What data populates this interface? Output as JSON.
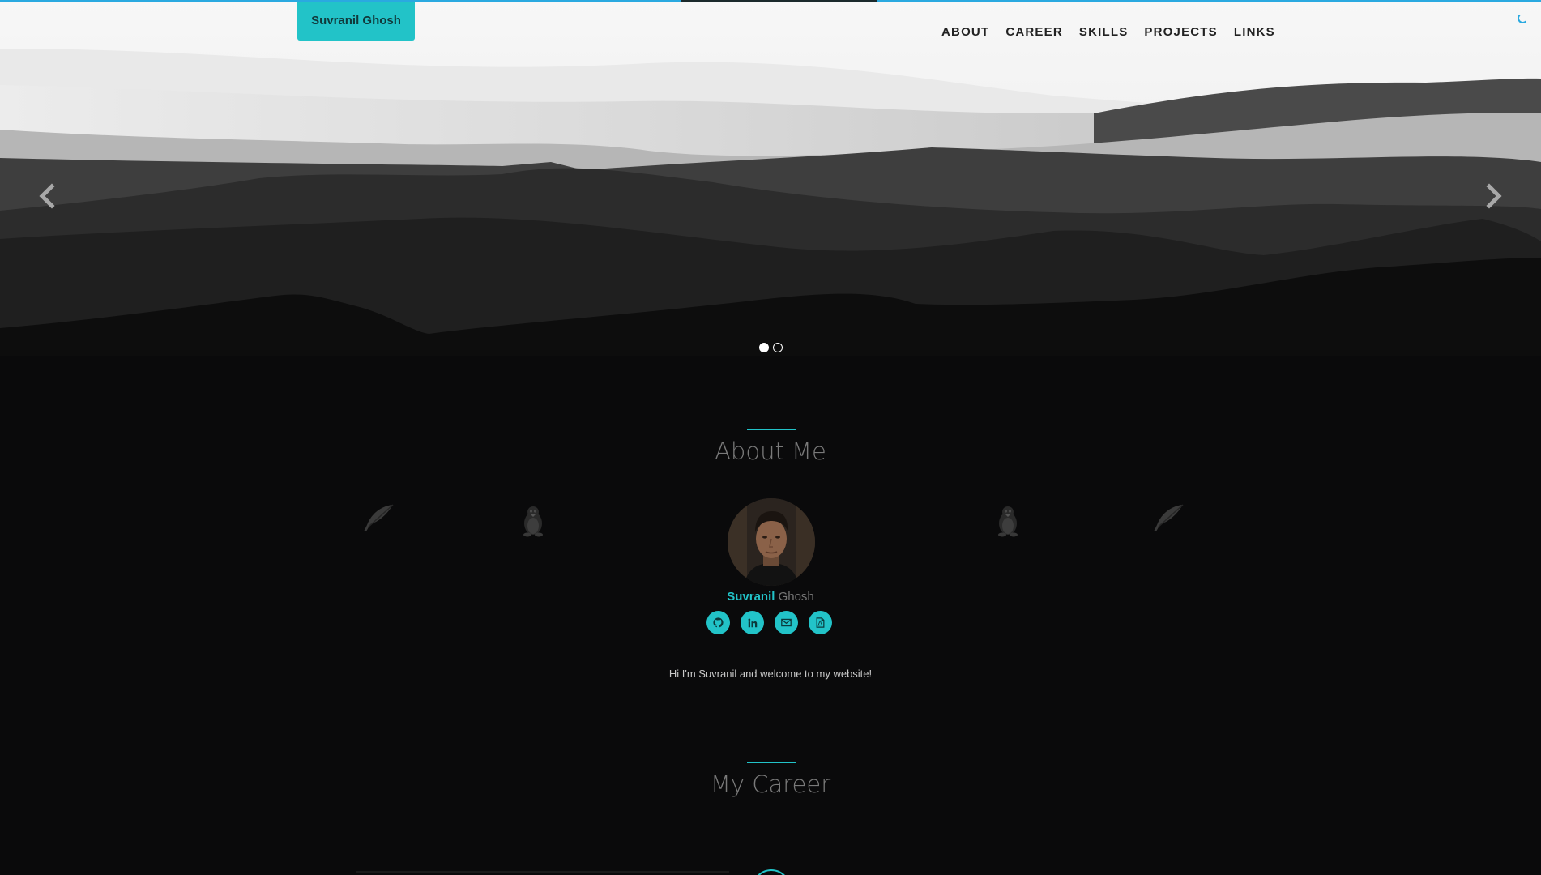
{
  "header": {
    "brand": "Suvranil Ghosh",
    "nav": [
      "ABOUT",
      "CAREER",
      "SKILLS",
      "PROJECTS",
      "LINKS"
    ]
  },
  "carousel": {
    "slide_count": 2,
    "active_index": 0
  },
  "about": {
    "title": "About Me",
    "first_name": "Suvranil",
    "last_name": "Ghosh",
    "welcome": "Hi I'm Suvranil and welcome to my website!",
    "socials": [
      "github-icon",
      "linkedin-icon",
      "envelope-icon",
      "pdf-file-icon"
    ]
  },
  "career": {
    "title": "My Career"
  },
  "colors": {
    "accent": "#22c3c8",
    "background": "#0a0a0b",
    "loading_bar": "#2aa9e0"
  }
}
